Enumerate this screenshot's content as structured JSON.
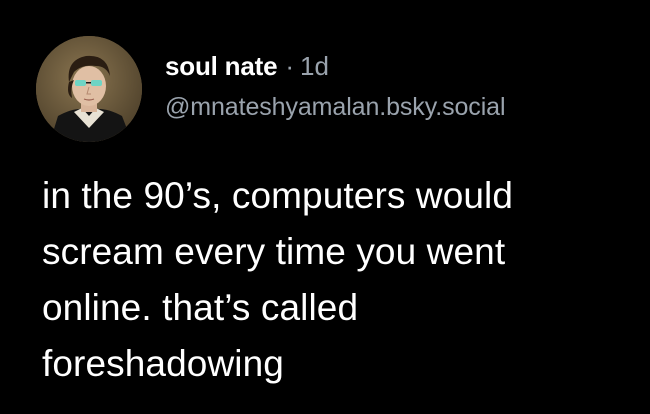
{
  "post": {
    "author": {
      "display_name": "soul nate",
      "handle": "@mnateshyamalan.bsky.social",
      "avatar_icon": "portrait-avatar"
    },
    "separator": "·",
    "timestamp": "1d",
    "text_lines": [
      "in the 90’s, computers would",
      "scream every time you went",
      "online. that’s called",
      "foreshadowing"
    ]
  },
  "colors": {
    "background": "#000000",
    "primary_text": "#ffffff",
    "secondary_text": "#9aa3ad"
  }
}
